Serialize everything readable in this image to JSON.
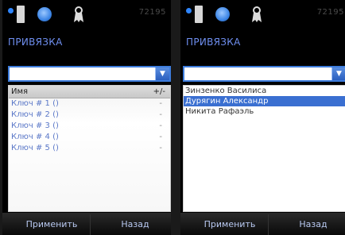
{
  "left": {
    "status_number": "72195",
    "title": "ПРИВЯЗКА",
    "dropdown_value": "",
    "table": {
      "header_name": "Имя",
      "header_action": "+/-",
      "rows": [
        {
          "name": "Ключ # 1 ()",
          "value": "-"
        },
        {
          "name": "Ключ # 2 ()",
          "value": "-"
        },
        {
          "name": "Ключ # 3 ()",
          "value": "-"
        },
        {
          "name": "Ключ # 4 ()",
          "value": "-"
        },
        {
          "name": "Ключ # 5 ()",
          "value": "-"
        }
      ]
    },
    "softkey_left": "Применить",
    "softkey_right": "Назад"
  },
  "right": {
    "status_number": "72195",
    "title": "ПРИВЯЗКА",
    "dropdown_value": "",
    "list_items": [
      {
        "label": "Зинзенко Василиса"
      },
      {
        "label": "Дурягин Александр",
        "selected": true
      },
      {
        "label": "Никита Рафаэль"
      }
    ],
    "softkey_left": "Применить",
    "softkey_right": "Назад"
  },
  "colors": {
    "accent": "#3d7cdc",
    "title": "#6f8ff0",
    "selected_row": "#3a6fd1"
  },
  "icons": [
    "status-dot-icon",
    "battery-icon",
    "globe-icon",
    "ribbon-icon",
    "dropdown-arrow-icon"
  ]
}
